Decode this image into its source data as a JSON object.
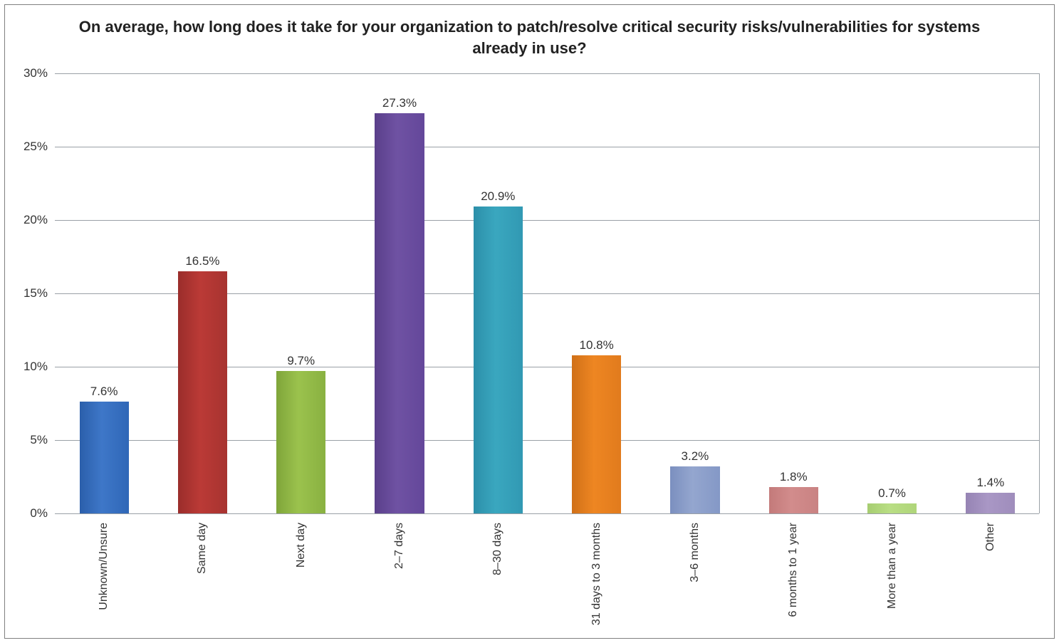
{
  "chart_data": {
    "type": "bar",
    "title": "On average, how long does it take for your organization to patch/resolve critical security risks/vulnerabilities for systems already in use?",
    "xlabel": "",
    "ylabel": "",
    "ylim": [
      0,
      30
    ],
    "yticks": [
      0,
      5,
      10,
      15,
      20,
      25,
      30
    ],
    "ytick_suffix": "%",
    "value_suffix": "%",
    "categories": [
      "Unknown/Unsure",
      "Same day",
      "Next day",
      "2–7 days",
      "8–30 days",
      "31 days to 3 months",
      "3–6 months",
      "6 months to 1 year",
      "More than a year",
      "Other"
    ],
    "values": [
      7.6,
      16.5,
      9.7,
      27.3,
      20.9,
      10.8,
      3.2,
      1.8,
      0.7,
      1.4
    ],
    "colors": [
      "#3e77c8",
      "#bb3a36",
      "#9bc24d",
      "#6f52a3",
      "#3aa7bf",
      "#ee8622",
      "#94a6cf",
      "#d28c8c",
      "#b9de84",
      "#a997c5"
    ]
  }
}
